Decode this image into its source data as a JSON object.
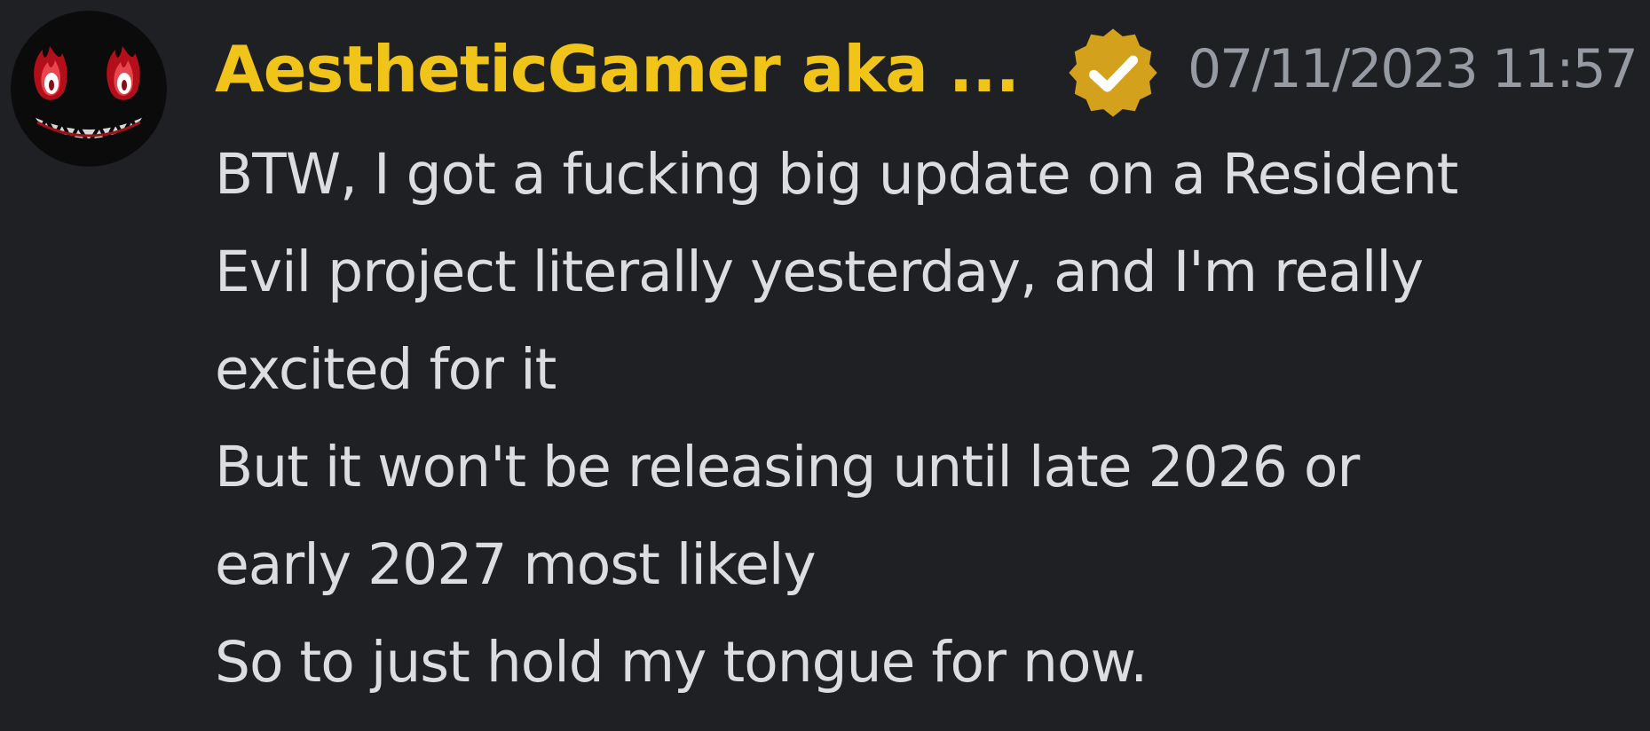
{
  "message": {
    "author": {
      "display_name": "AestheticGamer aka ...",
      "badge_icon": "verified-check-icon",
      "name_color": "#f0c419",
      "badge_color": "#d4a11c"
    },
    "timestamp": "07/11/2023 11:57",
    "lines": [
      "BTW, I got a fucking big update on a Resident",
      "Evil project literally yesterday, and I'm really",
      "excited for it",
      "But it won't be releasing until late 2026 or",
      "early 2027 most likely",
      "So to just hold my tongue for now."
    ]
  },
  "colors": {
    "background": "#1f2023",
    "text": "#dcdde1",
    "timestamp": "#959aa3"
  }
}
